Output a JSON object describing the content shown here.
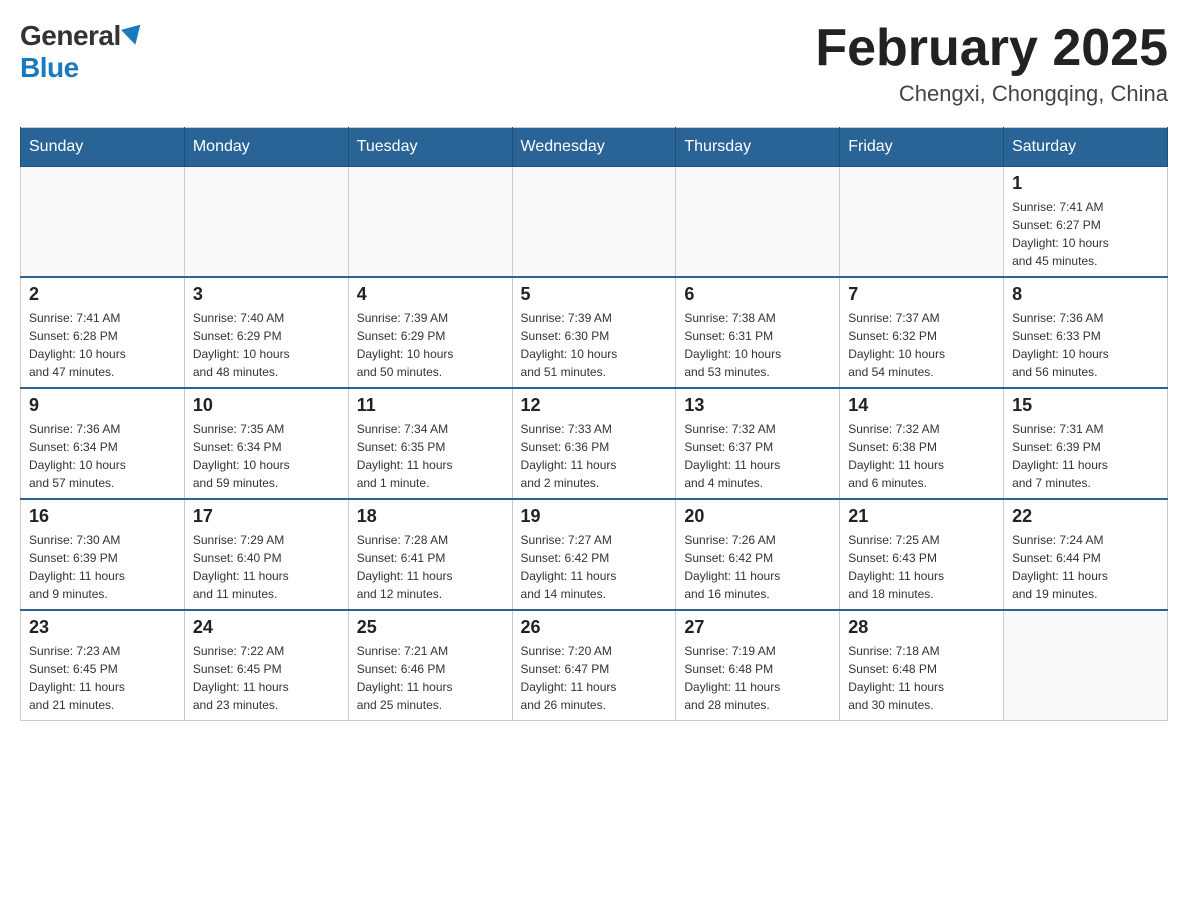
{
  "logo": {
    "general": "General",
    "blue": "Blue"
  },
  "title": "February 2025",
  "location": "Chengxi, Chongqing, China",
  "days_of_week": [
    "Sunday",
    "Monday",
    "Tuesday",
    "Wednesday",
    "Thursday",
    "Friday",
    "Saturday"
  ],
  "weeks": [
    [
      {
        "day": "",
        "info": ""
      },
      {
        "day": "",
        "info": ""
      },
      {
        "day": "",
        "info": ""
      },
      {
        "day": "",
        "info": ""
      },
      {
        "day": "",
        "info": ""
      },
      {
        "day": "",
        "info": ""
      },
      {
        "day": "1",
        "info": "Sunrise: 7:41 AM\nSunset: 6:27 PM\nDaylight: 10 hours\nand 45 minutes."
      }
    ],
    [
      {
        "day": "2",
        "info": "Sunrise: 7:41 AM\nSunset: 6:28 PM\nDaylight: 10 hours\nand 47 minutes."
      },
      {
        "day": "3",
        "info": "Sunrise: 7:40 AM\nSunset: 6:29 PM\nDaylight: 10 hours\nand 48 minutes."
      },
      {
        "day": "4",
        "info": "Sunrise: 7:39 AM\nSunset: 6:29 PM\nDaylight: 10 hours\nand 50 minutes."
      },
      {
        "day": "5",
        "info": "Sunrise: 7:39 AM\nSunset: 6:30 PM\nDaylight: 10 hours\nand 51 minutes."
      },
      {
        "day": "6",
        "info": "Sunrise: 7:38 AM\nSunset: 6:31 PM\nDaylight: 10 hours\nand 53 minutes."
      },
      {
        "day": "7",
        "info": "Sunrise: 7:37 AM\nSunset: 6:32 PM\nDaylight: 10 hours\nand 54 minutes."
      },
      {
        "day": "8",
        "info": "Sunrise: 7:36 AM\nSunset: 6:33 PM\nDaylight: 10 hours\nand 56 minutes."
      }
    ],
    [
      {
        "day": "9",
        "info": "Sunrise: 7:36 AM\nSunset: 6:34 PM\nDaylight: 10 hours\nand 57 minutes."
      },
      {
        "day": "10",
        "info": "Sunrise: 7:35 AM\nSunset: 6:34 PM\nDaylight: 10 hours\nand 59 minutes."
      },
      {
        "day": "11",
        "info": "Sunrise: 7:34 AM\nSunset: 6:35 PM\nDaylight: 11 hours\nand 1 minute."
      },
      {
        "day": "12",
        "info": "Sunrise: 7:33 AM\nSunset: 6:36 PM\nDaylight: 11 hours\nand 2 minutes."
      },
      {
        "day": "13",
        "info": "Sunrise: 7:32 AM\nSunset: 6:37 PM\nDaylight: 11 hours\nand 4 minutes."
      },
      {
        "day": "14",
        "info": "Sunrise: 7:32 AM\nSunset: 6:38 PM\nDaylight: 11 hours\nand 6 minutes."
      },
      {
        "day": "15",
        "info": "Sunrise: 7:31 AM\nSunset: 6:39 PM\nDaylight: 11 hours\nand 7 minutes."
      }
    ],
    [
      {
        "day": "16",
        "info": "Sunrise: 7:30 AM\nSunset: 6:39 PM\nDaylight: 11 hours\nand 9 minutes."
      },
      {
        "day": "17",
        "info": "Sunrise: 7:29 AM\nSunset: 6:40 PM\nDaylight: 11 hours\nand 11 minutes."
      },
      {
        "day": "18",
        "info": "Sunrise: 7:28 AM\nSunset: 6:41 PM\nDaylight: 11 hours\nand 12 minutes."
      },
      {
        "day": "19",
        "info": "Sunrise: 7:27 AM\nSunset: 6:42 PM\nDaylight: 11 hours\nand 14 minutes."
      },
      {
        "day": "20",
        "info": "Sunrise: 7:26 AM\nSunset: 6:42 PM\nDaylight: 11 hours\nand 16 minutes."
      },
      {
        "day": "21",
        "info": "Sunrise: 7:25 AM\nSunset: 6:43 PM\nDaylight: 11 hours\nand 18 minutes."
      },
      {
        "day": "22",
        "info": "Sunrise: 7:24 AM\nSunset: 6:44 PM\nDaylight: 11 hours\nand 19 minutes."
      }
    ],
    [
      {
        "day": "23",
        "info": "Sunrise: 7:23 AM\nSunset: 6:45 PM\nDaylight: 11 hours\nand 21 minutes."
      },
      {
        "day": "24",
        "info": "Sunrise: 7:22 AM\nSunset: 6:45 PM\nDaylight: 11 hours\nand 23 minutes."
      },
      {
        "day": "25",
        "info": "Sunrise: 7:21 AM\nSunset: 6:46 PM\nDaylight: 11 hours\nand 25 minutes."
      },
      {
        "day": "26",
        "info": "Sunrise: 7:20 AM\nSunset: 6:47 PM\nDaylight: 11 hours\nand 26 minutes."
      },
      {
        "day": "27",
        "info": "Sunrise: 7:19 AM\nSunset: 6:48 PM\nDaylight: 11 hours\nand 28 minutes."
      },
      {
        "day": "28",
        "info": "Sunrise: 7:18 AM\nSunset: 6:48 PM\nDaylight: 11 hours\nand 30 minutes."
      },
      {
        "day": "",
        "info": ""
      }
    ]
  ]
}
